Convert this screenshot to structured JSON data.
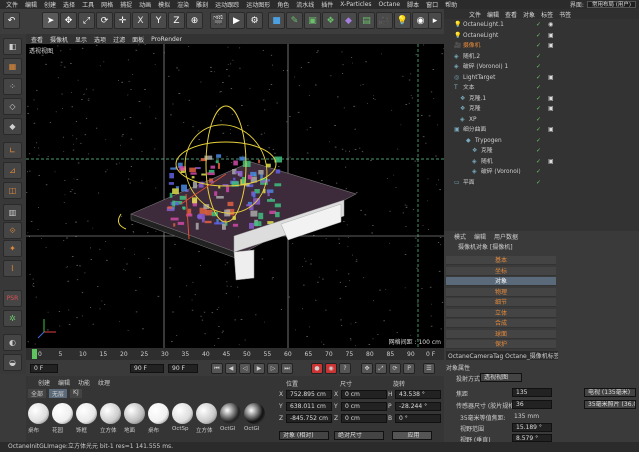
{
  "menu": [
    "文件",
    "编辑",
    "创建",
    "选择",
    "工具",
    "网格",
    "捕捉",
    "动画",
    "模拟",
    "渲染",
    "雕刻",
    "运动跟踪",
    "运动图形",
    "角色",
    "流水线",
    "插件",
    "X-Particles",
    "Octane",
    "脚本",
    "窗口",
    "帮助"
  ],
  "layout": {
    "label": "界面:",
    "value": "常用布局 (用户)"
  },
  "toolbar_axes": [
    "X",
    "Y",
    "Z"
  ],
  "viewport_menu": [
    "查看",
    "摄像机",
    "显示",
    "选项",
    "过滤",
    "面板",
    "ProRender"
  ],
  "viewport_title": "透视视图",
  "grid_spacing": "网格间距 : 100 cm",
  "timeline": {
    "ticks": [
      "0",
      "5",
      "10",
      "15",
      "20",
      "25",
      "30",
      "35",
      "40",
      "45",
      "50",
      "55",
      "60",
      "65",
      "70",
      "75",
      "80",
      "85",
      "90"
    ],
    "end": "0 F",
    "start_field": "0 F",
    "end_field": "90 F",
    "end_field2": "90 F"
  },
  "object_manager": {
    "menu": [
      "文件",
      "编辑",
      "查看",
      "对象",
      "标签",
      "书签"
    ],
    "rows": [
      "OctaneLight.1",
      "OctaneLight",
      "摄像机",
      "随机.2",
      "破碎 (Voronoi) 1",
      "LightTarget",
      "文本",
      "克隆.1",
      "克隆",
      "XP",
      "细分曲面",
      "Trypogen",
      "克隆",
      "随机",
      "破碎 (Voronoi)",
      "平面"
    ]
  },
  "attributes": {
    "menu": [
      "模式",
      "编辑",
      "用户数据"
    ],
    "title": "摄像机对象 [摄像机]",
    "tabs": [
      "基本",
      "坐标",
      "对象",
      "物理",
      "细节",
      "立体",
      "合成",
      "球面",
      "保护"
    ],
    "active_tab": "对象",
    "tag_bar": "OctaneCameraTag Octane_摄像机标签",
    "section": "对象属性",
    "projection_label": "投射方式",
    "projection_value": "透视视图",
    "focal_label": "焦距",
    "focal_value": "135",
    "focal_preset": "电视 (135毫米)",
    "sensor_label": "传感器尺寸 (胶片规格)",
    "sensor_value": "36",
    "sensor_preset": "35毫米照片 (36.0毫米)",
    "equiv_label": "35毫米等值焦距:",
    "equiv_value": "135 mm",
    "fov_label": "视野范围",
    "fov_value": "15.189 °",
    "fov2_label": "视野 (垂直)",
    "fov2_value": "8.579 °"
  },
  "materials": {
    "menu": [
      "创建",
      "编辑",
      "功能",
      "纹理"
    ],
    "tabs": [
      "全部",
      "无层",
      "KJ"
    ],
    "items": [
      "桌布",
      "花园",
      "饰框",
      "立方体",
      "地面",
      "桌布",
      "OctSp",
      "立方体",
      "OctGl",
      "OctGl"
    ],
    "colors": [
      "#ddd",
      "#eee",
      "#e8e8e8",
      "#ccc",
      "#bbb",
      "#f0f0f0",
      "#dcdcdc",
      "#c8c8c8",
      "#222",
      "#111"
    ]
  },
  "coordinates": {
    "headers": [
      "位置",
      "尺寸",
      "旋转"
    ],
    "rows": [
      {
        "axis": "X",
        "pos": "752.895 cm",
        "size": "0 cm",
        "rot_axis": "H",
        "rot": "43.538 °"
      },
      {
        "axis": "Y",
        "pos": "638.011 cm",
        "size": "0 cm",
        "rot_axis": "P",
        "rot": "-28.244 °"
      },
      {
        "axis": "Z",
        "pos": "-845.752 cm",
        "size": "0 cm",
        "rot_axis": "B",
        "rot": "0 °"
      }
    ],
    "mode1": "对象 (相对)",
    "mode2": "绝对尺寸",
    "apply": "应用"
  },
  "status": "OctaneInitGLImage:立方体光元  bit-1 res=1 141.555 ms."
}
